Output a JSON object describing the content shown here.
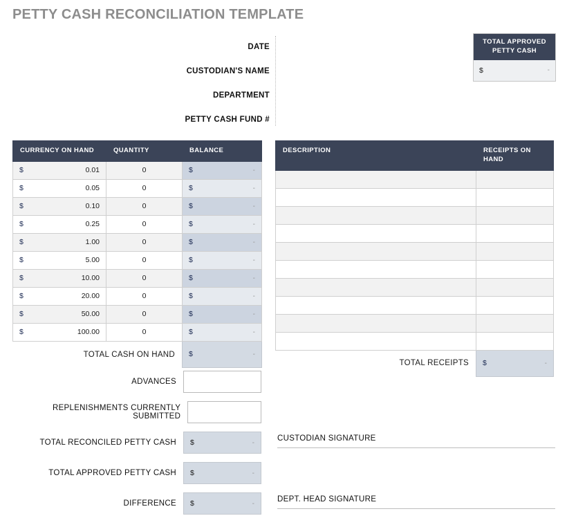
{
  "title": "PETTY CASH RECONCILIATION TEMPLATE",
  "form": {
    "fields": [
      {
        "label": "DATE",
        "value": ""
      },
      {
        "label": "CUSTODIAN'S NAME",
        "value": ""
      },
      {
        "label": "DEPARTMENT",
        "value": ""
      },
      {
        "label": "PETTY CASH FUND #",
        "value": ""
      }
    ]
  },
  "approved_box": {
    "heading": "TOTAL APPROVED PETTY CASH",
    "currency_symbol": "$",
    "value": "-"
  },
  "currency_table": {
    "headers": [
      "CURRENCY ON HAND",
      "QUANTITY",
      "BALANCE"
    ],
    "currency_symbol": "$",
    "rows": [
      {
        "denomination": "0.01",
        "quantity": "0",
        "balance": "-"
      },
      {
        "denomination": "0.05",
        "quantity": "0",
        "balance": "-"
      },
      {
        "denomination": "0.10",
        "quantity": "0",
        "balance": "-"
      },
      {
        "denomination": "0.25",
        "quantity": "0",
        "balance": "-"
      },
      {
        "denomination": "1.00",
        "quantity": "0",
        "balance": "-"
      },
      {
        "denomination": "5.00",
        "quantity": "0",
        "balance": "-"
      },
      {
        "denomination": "10.00",
        "quantity": "0",
        "balance": "-"
      },
      {
        "denomination": "20.00",
        "quantity": "0",
        "balance": "-"
      },
      {
        "denomination": "50.00",
        "quantity": "0",
        "balance": "-"
      },
      {
        "denomination": "100.00",
        "quantity": "0",
        "balance": "-"
      }
    ],
    "total_label": "TOTAL CASH ON HAND",
    "total_value": "-"
  },
  "receipts_table": {
    "headers": [
      "DESCRIPTION",
      "RECEIPTS ON HAND"
    ],
    "currency_symbol": "$",
    "rows": [
      {
        "description": "",
        "receipt": ""
      },
      {
        "description": "",
        "receipt": ""
      },
      {
        "description": "",
        "receipt": ""
      },
      {
        "description": "",
        "receipt": ""
      },
      {
        "description": "",
        "receipt": ""
      },
      {
        "description": "",
        "receipt": ""
      },
      {
        "description": "",
        "receipt": ""
      },
      {
        "description": "",
        "receipt": ""
      },
      {
        "description": "",
        "receipt": ""
      },
      {
        "description": "",
        "receipt": ""
      }
    ],
    "total_label": "TOTAL RECEIPTS",
    "total_value": "-"
  },
  "summary": {
    "rows": [
      {
        "label": "ADVANCES",
        "type": "input",
        "value": ""
      },
      {
        "label": "REPLENISHMENTS CURRENTLY SUBMITTED",
        "type": "input",
        "value": ""
      },
      {
        "label": "TOTAL RECONCILED PETTY CASH",
        "type": "value",
        "currency_symbol": "$",
        "value": "-"
      },
      {
        "label": "TOTAL APPROVED PETTY CASH",
        "type": "value",
        "currency_symbol": "$",
        "value": "-"
      },
      {
        "label": "DIFFERENCE",
        "type": "value",
        "currency_symbol": "$",
        "value": "-"
      }
    ]
  },
  "signatures": [
    {
      "label": "CUSTODIAN SIGNATURE"
    },
    {
      "label": "DEPT. HEAD SIGNATURE"
    }
  ],
  "colors": {
    "header_navy": "#3b4458",
    "title_gray": "#8d8d8d",
    "balance_dark": "#ccd4e0",
    "balance_light": "#e6eaef",
    "total_fill": "#d3dae3",
    "row_stripe": "#f2f2f2"
  }
}
